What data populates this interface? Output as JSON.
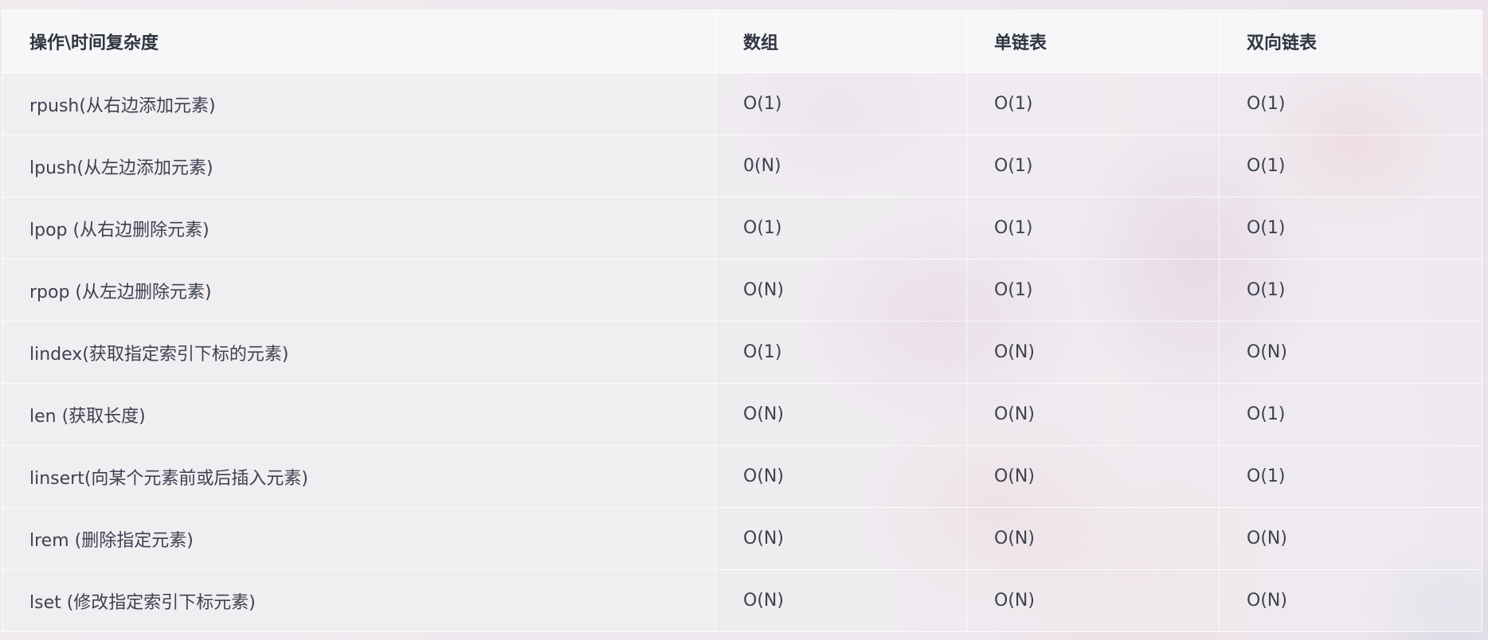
{
  "table": {
    "headers": [
      "操作\\时间复杂度",
      "数组",
      "单链表",
      "双向链表"
    ],
    "rows": [
      [
        "rpush(从右边添加元素)",
        "O(1)",
        "O(1)",
        "O(1)"
      ],
      [
        "lpush(从左边添加元素)",
        "0(N)",
        "O(1)",
        "O(1)"
      ],
      [
        "lpop (从右边删除元素)",
        "O(1)",
        "O(1)",
        "O(1)"
      ],
      [
        "rpop (从左边删除元素)",
        "O(N)",
        "O(1)",
        "O(1)"
      ],
      [
        "lindex(获取指定索引下标的元素)",
        "O(1)",
        "O(N)",
        "O(N)"
      ],
      [
        "len (获取长度)",
        "O(N)",
        "O(N)",
        "O(1)"
      ],
      [
        "linsert(向某个元素前或后插入元素)",
        "O(N)",
        "O(N)",
        "O(1)"
      ],
      [
        "lrem (删除指定元素)",
        "O(N)",
        "O(N)",
        "O(N)"
      ],
      [
        "lset (修改指定索引下标元素)",
        "O(N)",
        "O(N)",
        "O(N)"
      ]
    ]
  }
}
